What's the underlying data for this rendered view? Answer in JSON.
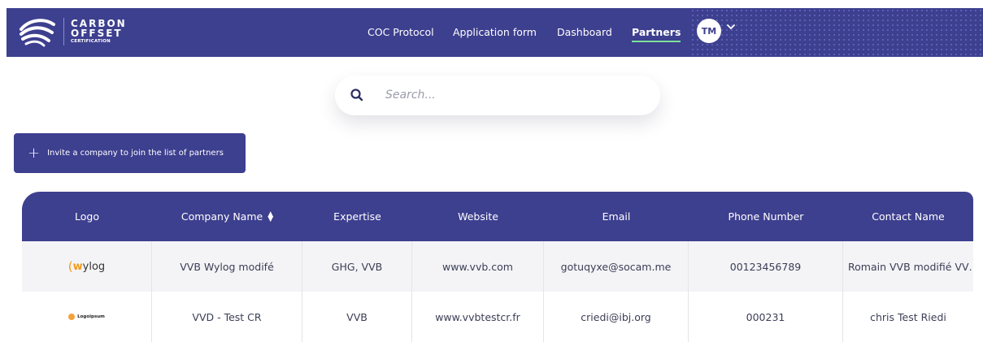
{
  "brand": {
    "line1": "CARBON",
    "line2": "OFFSET",
    "line3": "CERTIFICATION"
  },
  "nav": {
    "items": [
      {
        "label": "COC Protocol"
      },
      {
        "label": "Application form"
      },
      {
        "label": "Dashboard"
      },
      {
        "label": "Partners",
        "active": true
      }
    ]
  },
  "user": {
    "initials": "TM"
  },
  "search": {
    "placeholder": "Search...",
    "value": ""
  },
  "invite_button": {
    "label": "Invite a company to join the list of partners"
  },
  "table": {
    "headers": [
      "Logo",
      "Company Name",
      "Expertise",
      "Website",
      "Email",
      "Phone Number",
      "Contact Name"
    ],
    "rows": [
      {
        "logo": {
          "text": "ylog",
          "mark": "w"
        },
        "company": "VVB Wylog modifé",
        "expertise": "GHG, VVB",
        "website": "www.vvb.com",
        "email": "gotuqyxe@socam.me",
        "phone": "00123456789",
        "contact": "Romain VVB modifié VV…"
      },
      {
        "logo": {
          "text": "Logoipsum"
        },
        "company": "VVD - Test CR",
        "expertise": "VVB",
        "website": "www.vvbtestcr.fr",
        "email": "criedi@ibj.org",
        "phone": "000231",
        "contact": "chris Test Riedi"
      }
    ]
  },
  "colors": {
    "primary": "#3d3f8f",
    "active_underline": "#7ee09a",
    "row_alt": "#f4f4f7"
  }
}
